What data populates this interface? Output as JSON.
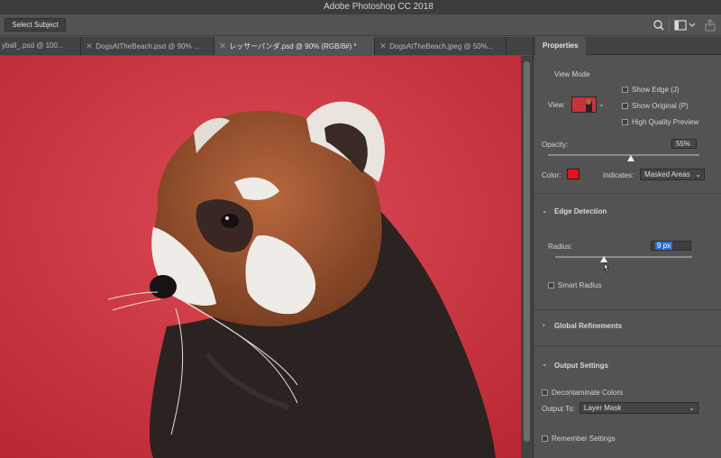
{
  "app": {
    "title": "Adobe Photoshop CC 2018"
  },
  "optionsbar": {
    "select_subject_label": "Select Subject"
  },
  "tabs": [
    {
      "label": "yball_.psd @ 100..."
    },
    {
      "label": "DogsAtTheBeach.psd @ 90% ..."
    },
    {
      "label": "レッサーパンダ.psd @ 90% (RGB/8#) *"
    },
    {
      "label": "DogsAtTheBeach.jpeg @ 50%..."
    }
  ],
  "properties": {
    "tab_label": "Properties",
    "view_mode": {
      "title": "View Mode",
      "view_label": "View:",
      "show_edge": "Show Edge (J)",
      "show_original": "Show Original (P)",
      "high_quality_preview": "High Quality Preview"
    },
    "opacity": {
      "label": "Opacity:",
      "value": "55%",
      "fraction": 0.55
    },
    "color": {
      "label": "Color:",
      "swatch": "#e8101e"
    },
    "indicates": {
      "label": "Indicates:",
      "value": "Masked Areas"
    },
    "edge_detection": {
      "title": "Edge Detection",
      "radius_label": "Radius:",
      "radius_value": "9 px",
      "smart_radius": "Smart Radius"
    },
    "global_refinements": {
      "title": "Global Refinements"
    },
    "output_settings": {
      "title": "Output Settings",
      "decontaminate": "Decontaminate Colors",
      "output_to_label": "Output To:",
      "output_to_value": "Layer Mask",
      "remember": "Remember Settings"
    }
  },
  "colors": {
    "canvas_background": "#c8323d",
    "accent_selection": "#2f6fd1"
  }
}
